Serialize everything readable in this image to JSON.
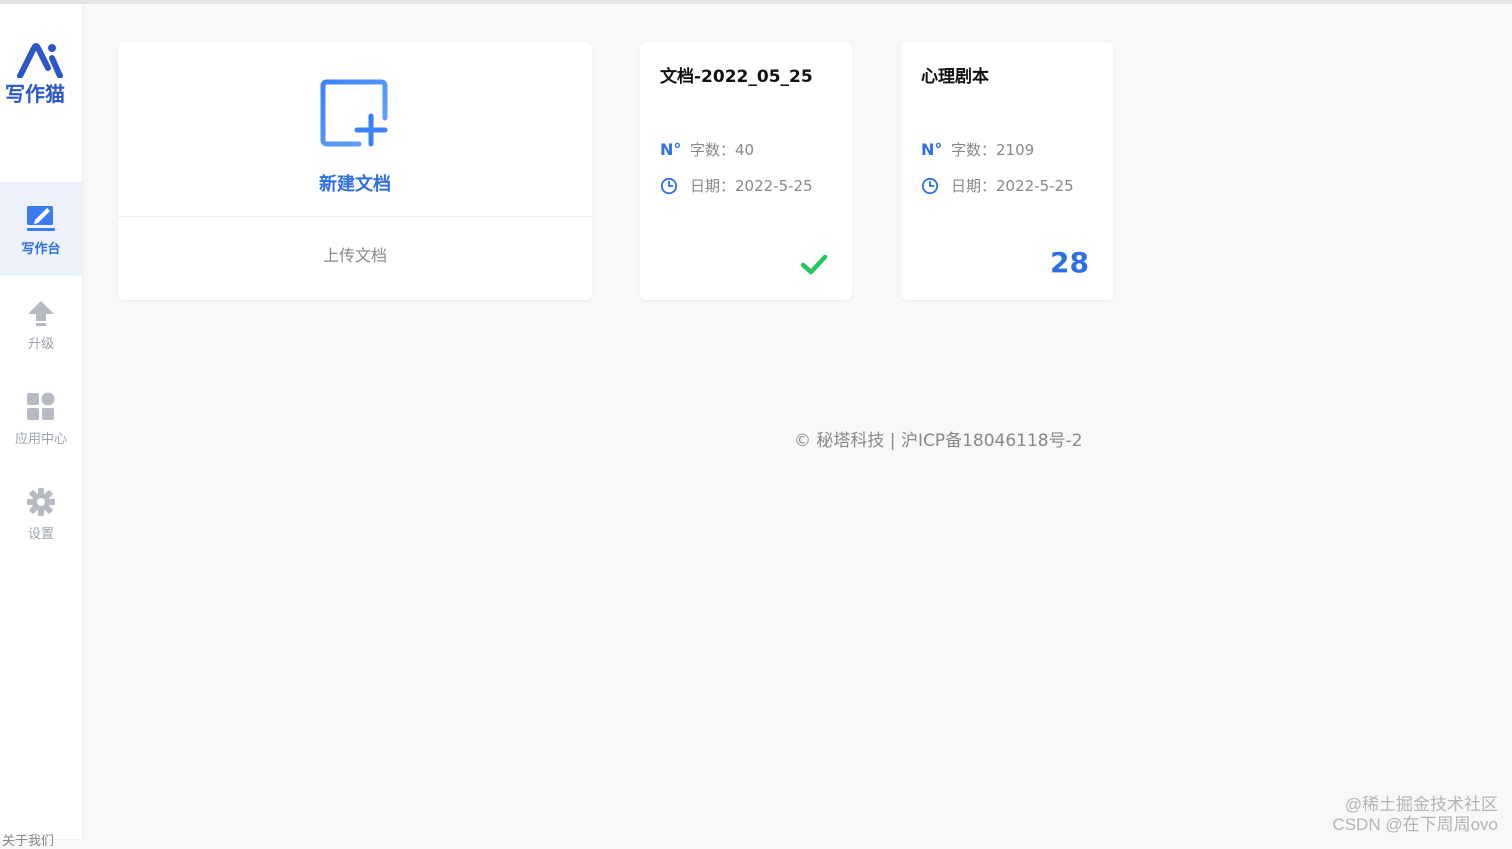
{
  "app": {
    "logo_text": "写作猫",
    "brand_color": "#2f6fe4"
  },
  "sidebar": {
    "items": [
      {
        "label": "写作台",
        "icon": "edit-icon",
        "active": true
      },
      {
        "label": "升级",
        "icon": "upgrade-arrow-icon",
        "active": false
      },
      {
        "label": "应用中心",
        "icon": "apps-grid-icon",
        "active": false
      },
      {
        "label": "设置",
        "icon": "gear-icon",
        "active": false
      }
    ],
    "about_label": "关于我们"
  },
  "new_document": {
    "label": "新建文档",
    "upload_label": "上传文档",
    "icon": "new-document-icon"
  },
  "documents": [
    {
      "title": "文档-2022_05_25",
      "words_label": "字数：",
      "words": "40",
      "date_label": "日期：",
      "date": "2022-5-25",
      "status_icon": "check-icon",
      "status_color": "#22c55e"
    },
    {
      "title": "心理剧本",
      "words_label": "字数：",
      "words": "2109",
      "date_label": "日期：",
      "date": "2022-5-25",
      "badge": "28"
    }
  ],
  "footer": {
    "copyright": "© 秘塔科技 | 沪ICP备18046118号-2"
  },
  "watermark": {
    "line1": "@稀土掘金技术社区",
    "line2": "CSDN @在下周周ovo"
  }
}
